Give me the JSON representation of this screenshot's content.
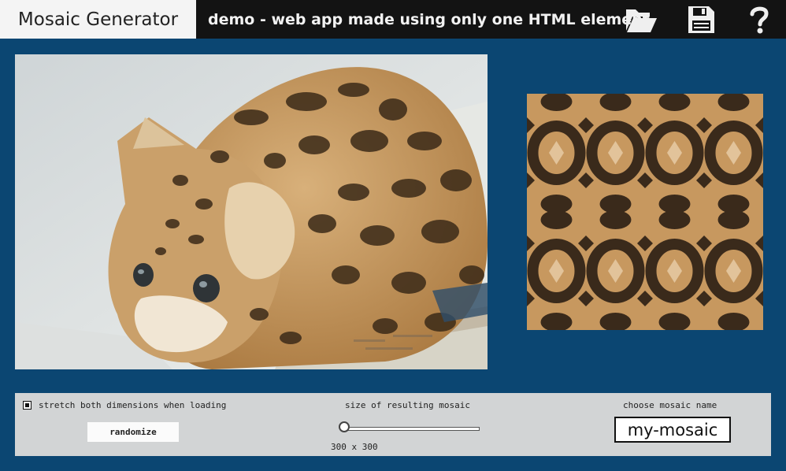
{
  "header": {
    "app_title": "Mosaic Generator",
    "subtitle": "demo - web app made using only one HTML element",
    "icons": [
      "folder-open-icon",
      "floppy-disk-icon",
      "question-mark-icon"
    ]
  },
  "controls": {
    "stretch_label": "stretch both dimensions when loading",
    "stretch_checked": true,
    "randomize_label": "randomize",
    "size_label": "size of resulting mosaic",
    "size_value": "300 x 300",
    "name_label": "choose mosaic name",
    "name_value": "my-mosaic"
  },
  "colors": {
    "page_background": "#0b4672",
    "header_background": "#131313",
    "panel_background": "#d2d4d5"
  }
}
